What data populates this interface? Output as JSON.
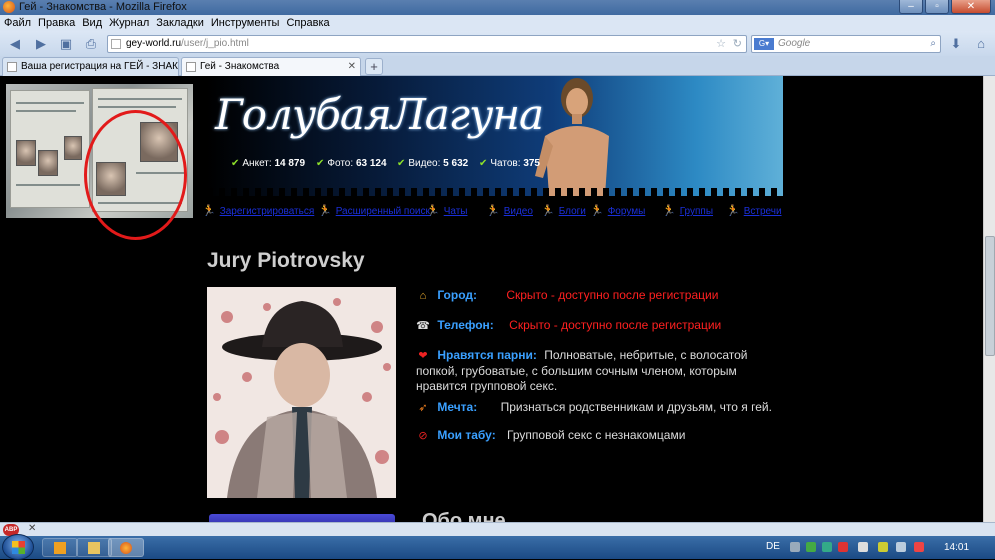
{
  "browser": {
    "window_title": "Гей - Знакомства - Mozilla Firefox",
    "menu": [
      "Файл",
      "Правка",
      "Вид",
      "Журнал",
      "Закладки",
      "Инструменты",
      "Справка"
    ],
    "url_host": "gey-world.ru",
    "url_path": "/user/j_pio.html",
    "search_placeholder": "Google",
    "tabs": [
      {
        "label": "Ваша регистрация на ГЕЙ - ЗНАКО..."
      },
      {
        "label": "Гей - Знакомства"
      }
    ],
    "new_tab_label": "+"
  },
  "site": {
    "logo": "ГолубаяЛагуна",
    "stats": [
      {
        "label": "Анкет:",
        "value": "14 879"
      },
      {
        "label": "Фото:",
        "value": "63 124"
      },
      {
        "label": "Видео:",
        "value": "5 632"
      },
      {
        "label": "Чатов:",
        "value": "375"
      }
    ],
    "nav": [
      "Зарегистрироваться",
      "Расширенный поиск",
      "Чаты",
      "Видео",
      "Блоги",
      "Форумы",
      "Группы",
      "Встречи"
    ]
  },
  "profile": {
    "name": "Jury Piotrovsky",
    "city_label": "Город:",
    "city_value": "Скрыто - доступно после регистрации",
    "phone_label": "Телефон:",
    "phone_value": "Скрыто - доступно после регистрации",
    "likes_label": "Нравятся парни:",
    "likes_value": "Полноватые, небритые, с волосатой попкой, грубоватые, с большим сочным членом, которым нравится групповой секс.",
    "dream_label": "Мечта:",
    "dream_value": "Признаться родственникам и друзьям, что я гей.",
    "taboo_label": "Мои табу:",
    "taboo_value": "Групповой секс с незнакомцами",
    "about_title": "Обо мне"
  },
  "taskbar": {
    "lang": "DE",
    "time": "14:01"
  },
  "colors": {
    "link_blue": "#1a2fd8",
    "label_blue": "#3aa0ff",
    "hidden_red": "#ff2020",
    "circle_red": "#e21a1a"
  }
}
